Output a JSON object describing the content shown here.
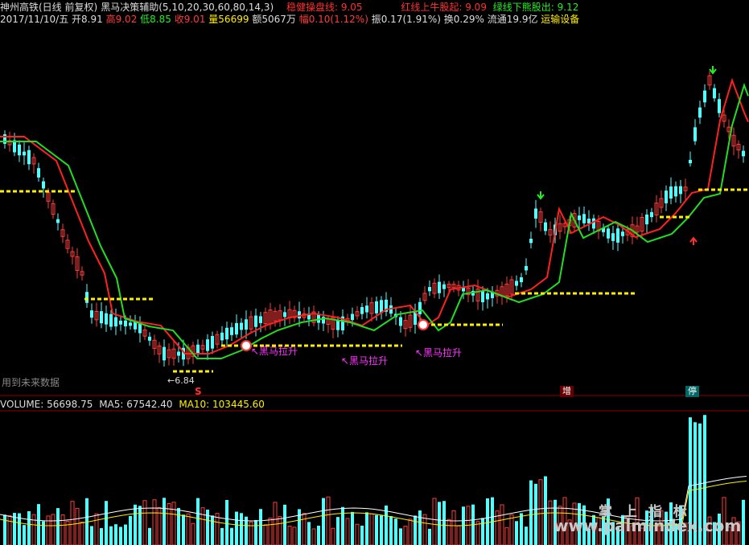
{
  "header": {
    "stock": "神州高铁(日线 前复权)",
    "indicator": "黑马决策辅助(5,10,20,30,60,80,14,3)",
    "stable_label": "稳健操盘线: 9.05",
    "red_label": "红线上牛股起: 9.09",
    "green_label": "绿线下熊股出: 9.12"
  },
  "quote": {
    "date": "2017/11/10/五",
    "open": "开8.91",
    "high": "高9.02",
    "low": "低8.85",
    "close": "收9.01",
    "volume": "量56699",
    "amount": "额5067万",
    "change": "幅0.10(1.12%)",
    "amplitude": "振0.17(1.91%)",
    "turnover": "换0.29%",
    "float_cap": "流通19.9亿",
    "sector": "运输设备"
  },
  "annotations": {
    "future_data": "用到未来数据",
    "low_price": "←6.84",
    "signal1": "↖黑马拉升",
    "signal2": "↖黑马拉升",
    "signal3": "↖黑马拉升",
    "marker_s": "S",
    "badge_zeng": "增",
    "badge_ting": "停"
  },
  "volume_header": {
    "volume": "VOLUME: 56698.75",
    "ma5": "MA5: 67542.40",
    "ma10": "MA10: 103445.60"
  },
  "watermark": {
    "title": "掌 上 指 标",
    "url": "www.palmindex.com"
  },
  "colors": {
    "up": "#ff3b3b",
    "down": "#54ffff",
    "ma_red": "#ff2020",
    "ma_green": "#22dd22",
    "support": "#ffee00",
    "signal": "#ff33ff"
  },
  "chart_data": {
    "type": "candlestick",
    "title": "神州高铁(日线 前复权)",
    "last_bar": {
      "date": "2017/11/10",
      "open": 8.91,
      "high": 9.02,
      "low": 8.85,
      "close": 9.01,
      "volume": 56699
    },
    "period_low": 6.84,
    "indicator_values": {
      "stable_line": 9.05,
      "red_line": 9.09,
      "green_line": 9.12
    },
    "volume_indicators": {
      "volume": 56698.75,
      "ma5": 67542.4,
      "ma10": 103445.6
    }
  }
}
